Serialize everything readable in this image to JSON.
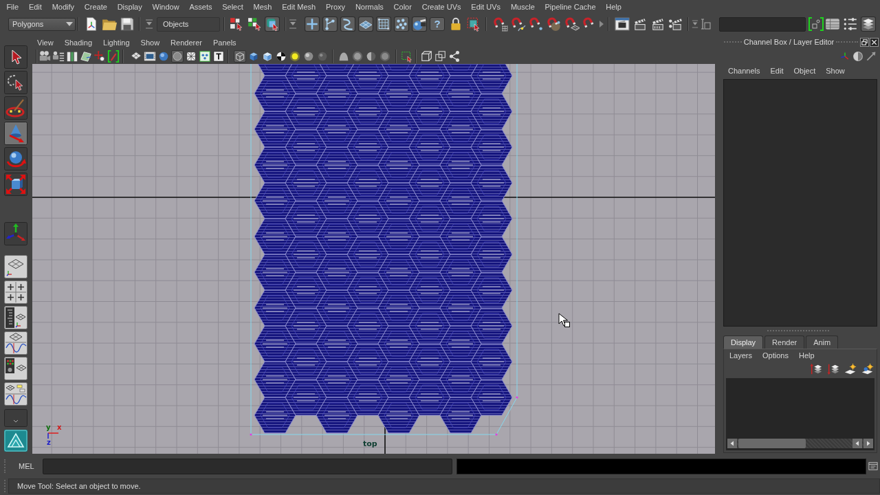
{
  "menu_bar": [
    "File",
    "Edit",
    "Modify",
    "Create",
    "Display",
    "Window",
    "Assets",
    "Select",
    "Mesh",
    "Edit Mesh",
    "Proxy",
    "Normals",
    "Color",
    "Create UVs",
    "Edit UVs",
    "Muscle",
    "Pipeline Cache",
    "Help"
  ],
  "status_line": {
    "menu_set": "Polygons",
    "selection_mask": "Objects",
    "select_modes": [
      {
        "selected": false
      },
      {
        "selected": false
      },
      {
        "selected": true
      }
    ],
    "mask_toggles": [
      {
        "on": true
      },
      {
        "on": true
      },
      {
        "on": true
      },
      {
        "on": true
      },
      {
        "on": true
      },
      {
        "on": true
      },
      {
        "on": true
      },
      {
        "on": true,
        "label": "?"
      }
    ],
    "panel_toggles": [
      {
        "on": false
      },
      {
        "on": false
      },
      {
        "on": true
      }
    ]
  },
  "toolbox": {
    "tools": [
      {
        "selected": false
      },
      {
        "selected": false
      },
      {
        "selected": false
      },
      {
        "selected": true
      },
      {
        "selected": false
      },
      {
        "selected": false
      },
      {
        "selected": false
      }
    ]
  },
  "model_panel": {
    "menus": [
      "View",
      "Shading",
      "Lighting",
      "Show",
      "Renderer",
      "Panels"
    ],
    "view_toggles": [
      {
        "on": false
      },
      {
        "on": false
      },
      {
        "on": false
      },
      {
        "on": true
      },
      {
        "on": false
      },
      {
        "on": false
      },
      {
        "on": false
      }
    ],
    "shading_toggles": [
      {
        "on": true
      },
      {
        "on": false
      },
      {
        "on": false
      },
      {
        "on": false
      },
      {
        "on": false
      },
      {
        "on": false
      },
      {
        "on": false
      }
    ],
    "camera": "top",
    "axis_labels": [
      "y",
      "x",
      "z"
    ]
  },
  "channel_box": {
    "title": "Channel Box / Layer Editor",
    "menus": [
      "Channels",
      "Edit",
      "Object",
      "Show"
    ]
  },
  "layer_editor": {
    "tabs": [
      {
        "label": "Display",
        "selected": true
      },
      {
        "label": "Render",
        "selected": false
      },
      {
        "label": "Anim",
        "selected": false
      }
    ],
    "menus": [
      "Layers",
      "Options",
      "Help"
    ]
  },
  "command_line": {
    "language": "MEL"
  },
  "help_line": "Move Tool: Select an object to move."
}
